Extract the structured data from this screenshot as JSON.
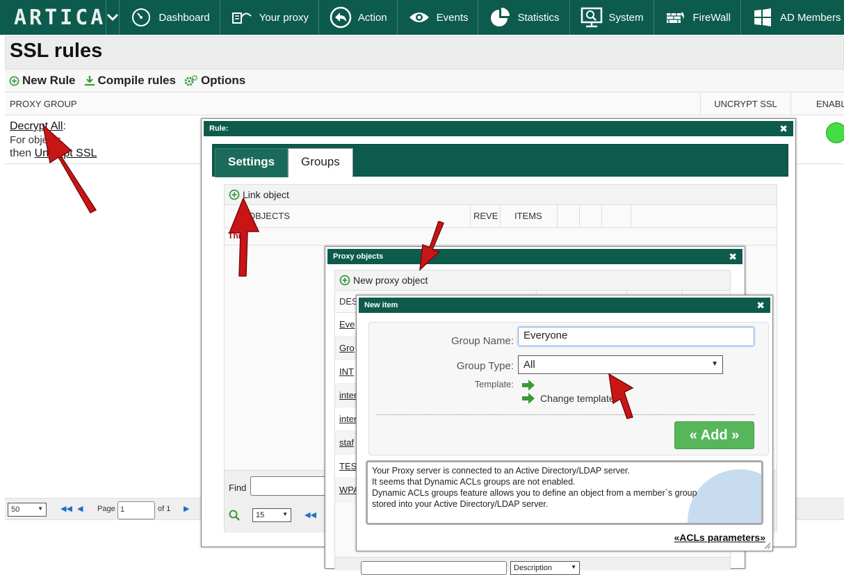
{
  "navbar": {
    "logo": "ARTICA",
    "items": [
      {
        "label": "Dashboard",
        "icon": "dashboard-icon"
      },
      {
        "label": "Your proxy",
        "icon": "proxy-icon"
      },
      {
        "label": "Action",
        "icon": "action-icon"
      },
      {
        "label": "Events",
        "icon": "eye-icon"
      },
      {
        "label": "Statistics",
        "icon": "pie-chart-icon"
      },
      {
        "label": "System",
        "icon": "monitor-icon"
      },
      {
        "label": "FireWall",
        "icon": "firewall-icon"
      },
      {
        "label": "AD Members",
        "icon": "windows-icon"
      }
    ]
  },
  "page": {
    "title": "SSL rules",
    "toolbar": {
      "new_rule": "New Rule",
      "compile": "Compile rules",
      "options": "Options"
    },
    "grid": {
      "headers": {
        "group": "PROXY GROUP",
        "uncrypt": "UNCRYPT SSL",
        "enable": "ENABLED"
      },
      "rule": {
        "name": "Decrypt All",
        "colon": ":",
        "line2": "For objects",
        "then": "then",
        "action": "Uncrypt SSL"
      }
    },
    "pager": {
      "rows": "50",
      "page_label": "Page",
      "page_value": "1",
      "of_label": "of 1"
    }
  },
  "rule_dialog": {
    "title": "Rule:",
    "tabs": {
      "settings": "Settings",
      "groups": "Groups"
    },
    "link_object": "Link object",
    "headers": {
      "objects": "OBJECTS",
      "reverse": "REVE",
      "items": "ITEMS"
    },
    "first_row": "Thi",
    "find_label": "Find",
    "rows_select": "15"
  },
  "proxy_dialog": {
    "title": "Proxy objects",
    "new_object": "New proxy object",
    "header": "DES",
    "rows": [
      "Eve",
      "Gro",
      "INT",
      "inter",
      "inter",
      "staf",
      "TES",
      "WPA"
    ],
    "bottom_select": "Description"
  },
  "newitem_dialog": {
    "title": "New item",
    "group_name_label": "Group Name:",
    "group_name_value": "Everyone",
    "group_type_label": "Group Type:",
    "group_type_value": "All",
    "template_label": "Template:",
    "change_template": "Change template",
    "add_button": "« Add »",
    "info": [
      "Your Proxy server is connected to an Active Directory/LDAP server.",
      "It seems that Dynamic ACLs groups are not enabled.",
      "Dynamic ACLs groups feature allows you to define an object from a member`s group",
      "stored into your Active Directory/LDAP server."
    ],
    "acl_link": "«ACLs parameters»"
  },
  "colors": {
    "brand": "#0d5b4c",
    "add_button": "#58b65a",
    "arrow": "#c81616",
    "enabled": "#44dd44"
  }
}
